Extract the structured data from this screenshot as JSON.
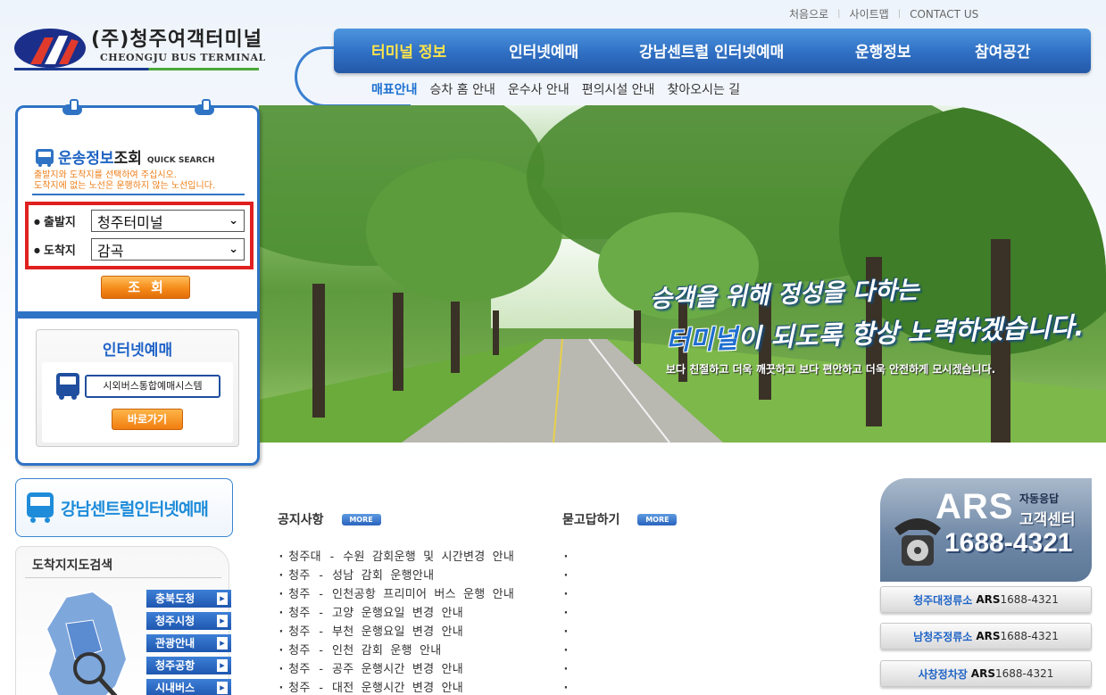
{
  "util": {
    "home": "처음으로",
    "sitemap": "사이트맵",
    "contact": "CONTACT US"
  },
  "logo": {
    "ko": "(주)청주여객터미널",
    "en": "CHEONGJU BUS TERMINAL"
  },
  "nav": {
    "items": [
      "터미널 정보",
      "인터넷예매",
      "강남센트럴 인터넷예매",
      "운행정보",
      "참여공간"
    ],
    "sub": [
      "매표안내",
      "승차 홈 안내",
      "운수사 안내",
      "편의시설 안내",
      "찾아오시는 길"
    ]
  },
  "hero": {
    "line1": "승객을 위해 정성을 다하는",
    "line2_hl": "터미널",
    "line2_rest": "이 되도록 항상 노력하겠습니다.",
    "line3": "보다 친절하고 더욱 깨끗하고 보다 편안하고 더욱 안전하게 모시겠습니다."
  },
  "quick_search": {
    "title_a": "운송정보",
    "title_b": "조회",
    "title_en": "QUICK SEARCH",
    "desc1": "출발지와 도착지를 선택하여 주십시오.",
    "desc2": "도착지에 없는 노선은 운행하지 않는 노선입니다.",
    "departure_label": "출발지",
    "departure_value": "청주터미널",
    "arrival_label": "도착지",
    "arrival_value": "감곡",
    "search_button": "조회"
  },
  "internet": {
    "title": "인터넷예매",
    "system": "시외버스통합예매시스템",
    "go": "바로가기"
  },
  "gangnam": {
    "text": "강남센트럴인터넷예매"
  },
  "map": {
    "title": "도착지지도검색",
    "buttons": [
      "충북도청",
      "청주시청",
      "관광안내",
      "청주공항",
      "시내버스"
    ]
  },
  "notice": {
    "title": "공지사항",
    "more": "MORE",
    "items": [
      "청주대 - 수원 감회운행 및 시간변경 안내",
      "청주 - 성남 감회 운행안내",
      "청주 - 인천공항 프리미어 버스 운행 안내",
      "청주 - 고양 운행요일 변경 안내",
      "청주 - 부천 운행요일 변경 안내",
      "청주 - 인천 감회 운행 안내",
      "청주 - 공주 운행시간 변경 안내",
      "청주 - 대전 운행시간 변경 안내"
    ]
  },
  "qna": {
    "title": "묻고답하기",
    "more": "MORE",
    "items": [
      "",
      "",
      "",
      "",
      "",
      "",
      "",
      ""
    ]
  },
  "ars": {
    "big": "ARS",
    "sub1": "자동응답",
    "sub2": "고객센터",
    "number": "1688-4321",
    "stops": [
      {
        "name": "청주대정류소",
        "ars": "ARS",
        "phone": "1688-4321"
      },
      {
        "name": "남청주정류소",
        "ars": "ARS",
        "phone": "1688-4321"
      },
      {
        "name": "사창정차장",
        "ars": "ARS",
        "phone": "1688-4321"
      }
    ]
  },
  "colors": {
    "brand_blue": "#2f73c5",
    "active_yellow": "#ffe44a",
    "accent_orange": "#f58b1a",
    "highlight_red": "#e02020"
  }
}
